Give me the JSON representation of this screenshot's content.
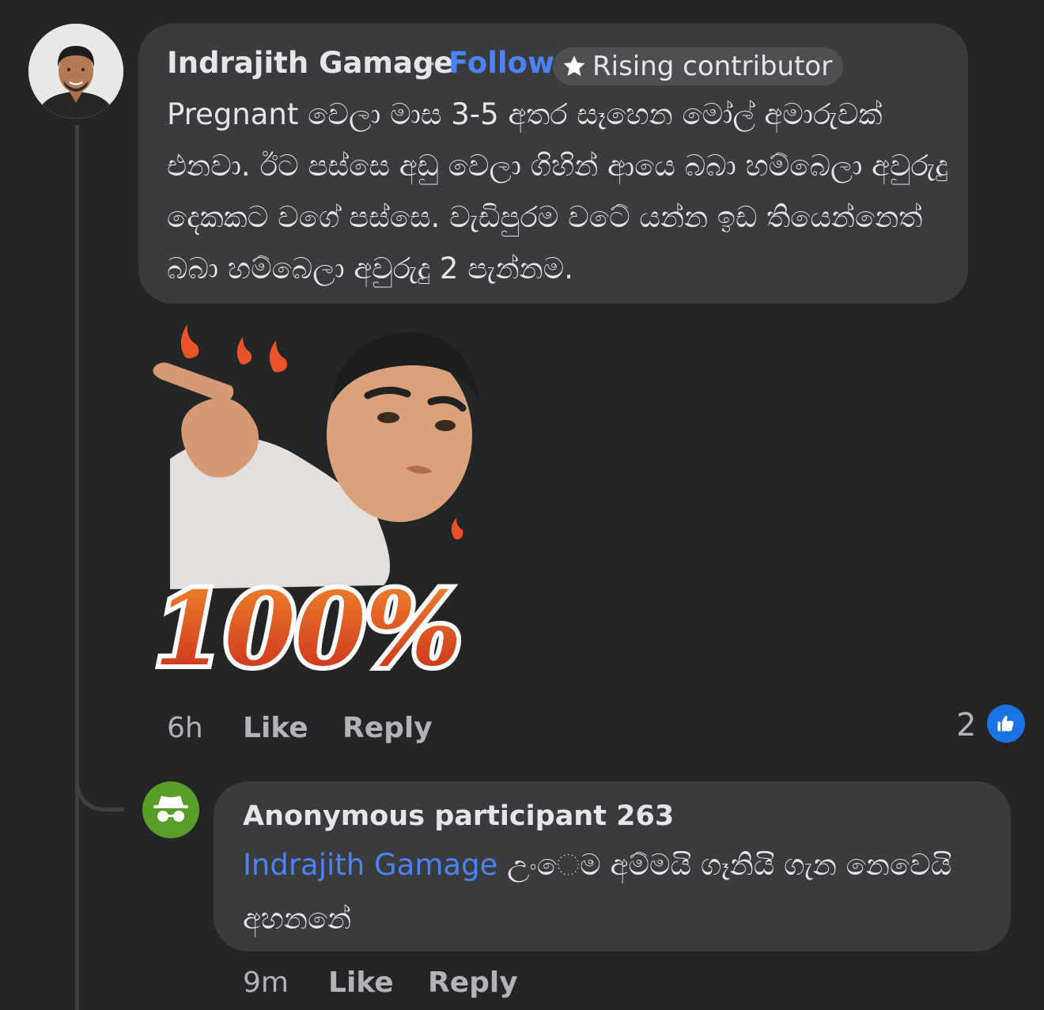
{
  "comment": {
    "author": "Indrajith Gamage",
    "separator": "·",
    "follow_label": "Follow",
    "badge_label": "Rising contributor",
    "badge_icon": "star-icon",
    "text": "Pregnant වෙලා මාස 3-5 අතර සෑහෙන මෝල් අමාරුවක් එනවා. ඊට පස්සෙ අඩු වෙලා ගිහින් ආයෙ බබා හම්බෙලා අවුරුදු දෙකකට වගේ පස්සෙ. වැඩිපුරම වටේ යන්න ඉඩ තියෙන්නෙත් බබා හම්බෙලා අවුරුදු 2 පැන්නම.",
    "sticker_text": "100%",
    "time": "6h",
    "like_label": "Like",
    "reply_label": "Reply",
    "reaction_count": "2",
    "reaction_icon": "like-thumb-icon"
  },
  "reply": {
    "author": "Anonymous participant 263",
    "avatar_icon": "anonymous-spy-icon",
    "mention": "Indrajith Gamage",
    "text": "උංෙම අම්මයි ගෑනියි ගැන නෙවෙයි අහනනේ",
    "time": "9m",
    "like_label": "Like",
    "reply_label": "Reply"
  },
  "colors": {
    "background": "#242526",
    "bubble": "#3a3b3c",
    "link": "#4b83f5",
    "like_blue": "#1b74e4",
    "anon_avatar": "#5a9e2a"
  }
}
